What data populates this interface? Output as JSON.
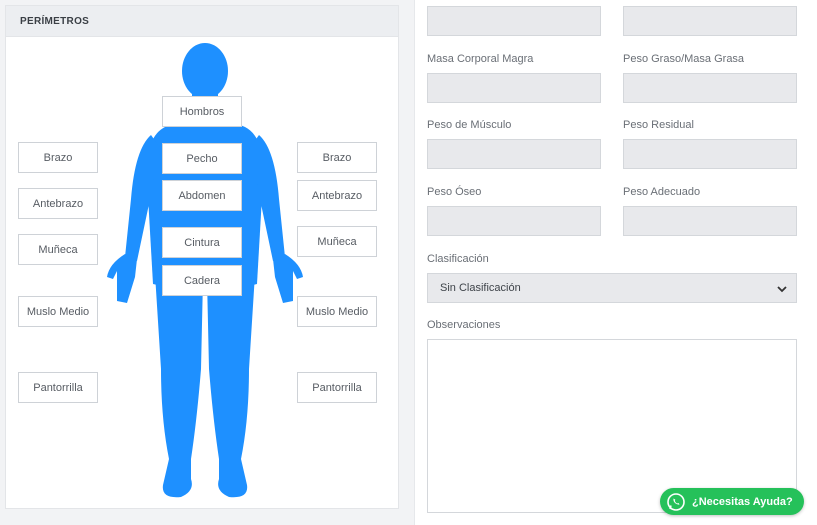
{
  "perimetros": {
    "title": "PERÍMETROS",
    "center": {
      "shoulders": "Hombros",
      "chest": "Pecho",
      "abdomen": "Abdomen",
      "waist": "Cintura",
      "hip": "Cadera"
    },
    "left": {
      "arm": "Brazo",
      "forearm": "Antebrazo",
      "wrist": "Muñeca",
      "mid_thigh": "Muslo Medio",
      "calf": "Pantorrilla"
    },
    "right": {
      "arm": "Brazo",
      "forearm": "Antebrazo",
      "wrist": "Muñeca",
      "mid_thigh": "Muslo Medio",
      "calf": "Pantorrilla"
    },
    "body_color": "#1e90ff"
  },
  "composition": {
    "lean_mass_label": "Masa Corporal Magra",
    "fat_mass_label": "Peso Graso/Masa Grasa",
    "muscle_label": "Peso de Músculo",
    "residual_label": "Peso Residual",
    "bone_label": "Peso Óseo",
    "adequate_label": "Peso Adecuado",
    "classification_label": "Clasificación",
    "classification_value": "Sin Clasificación",
    "observations_label": "Observaciones"
  },
  "help": {
    "label": "¿Necesitas Ayuda?",
    "color": "#25c15a"
  }
}
